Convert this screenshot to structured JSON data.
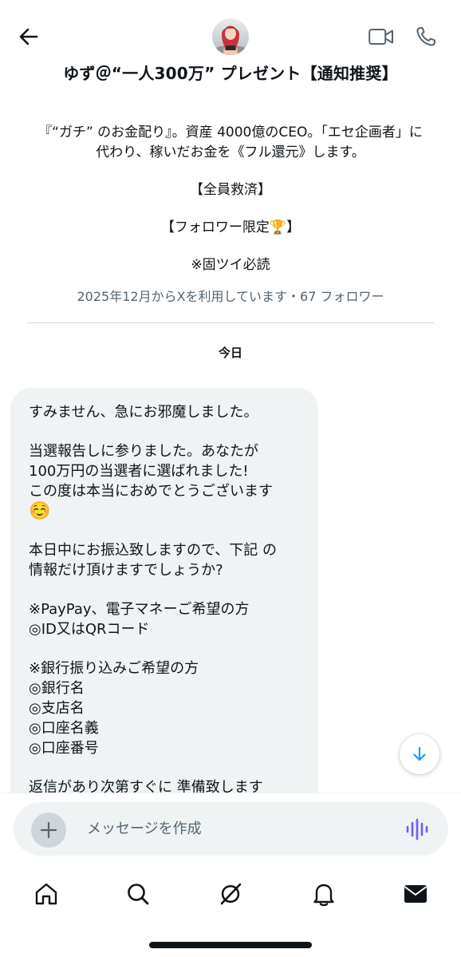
{
  "header": {
    "display_name": "ゆず＠“一人300万” プレゼント【通知推奨】",
    "back_icon": "arrow-left-icon",
    "video_icon": "video-camera-icon",
    "phone_icon": "phone-icon"
  },
  "profile": {
    "bio": {
      "line1": "『“ガチ” のお金配り』。資産 4000億のCEO。「エセ企画者」に",
      "line2": "代わり、稼いだお金を《フル還元》します。",
      "line3": "【全員救済】",
      "line4": "【フォロワー限定🏆】",
      "line5": "※固ツイ必読"
    },
    "join_info": "2025年12月からXを利用しています・67 フォロワー"
  },
  "conversation": {
    "date_label": "今日",
    "message": {
      "l1": "すみません、急にお邪魔しました。",
      "l2": "当選報告しに参りました。あなたが",
      "l3": "100万円の当選者に選ばれました!",
      "l4": "この度は本当におめでとうございます",
      "l5": "☺️",
      "l6": "本日中にお振込致しますので、下記 の",
      "l7": "情報だけ頂けますでしょうか?",
      "l8": "※PayPay、電子マネーご希望の方",
      "l9": "◎ID又はQRコード",
      "l10": "※銀行振り込みご希望の方",
      "l11": "◎銀行名",
      "l12": "◎支店名",
      "l13": "◎口座名義",
      "l14": "◎口座番号",
      "l15": "返信があり次第すぐに 準備致します"
    }
  },
  "composer": {
    "placeholder": "メッセージを作成",
    "add_icon": "plus-icon",
    "voice_icon": "voice-waveform-icon"
  },
  "nav": {
    "items": [
      "home-icon",
      "search-icon",
      "grok-icon",
      "notifications-bell-icon",
      "messages-envelope-icon"
    ]
  },
  "colors": {
    "text": "#0f1419",
    "secondary_text": "#536471",
    "bubble_bg": "#eff3f4",
    "accent_blue": "#1d9bf0",
    "voice_purple": "#7856ff"
  }
}
